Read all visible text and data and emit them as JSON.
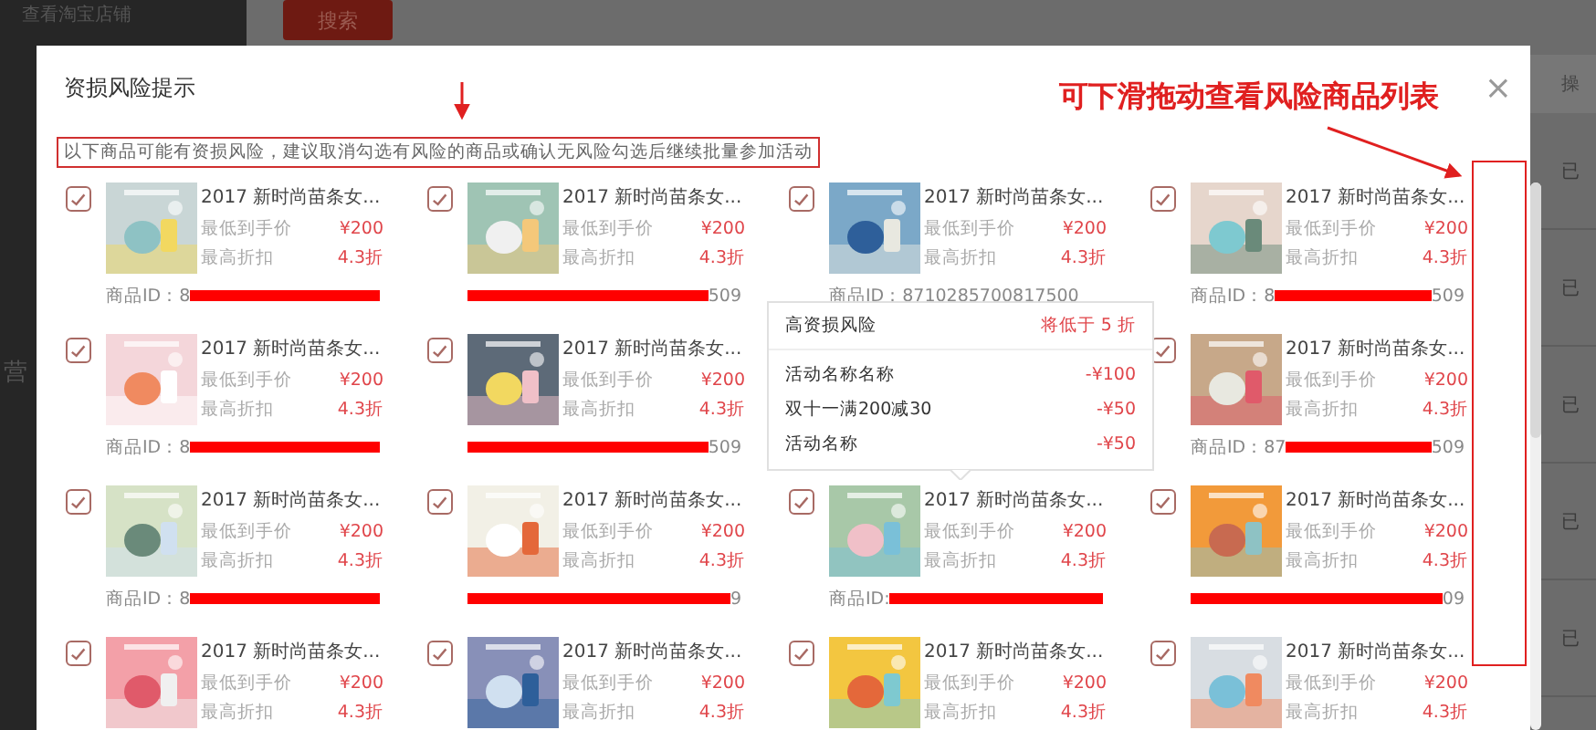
{
  "background": {
    "sidebar_items": [
      "查看淘宝店铺",
      "营"
    ],
    "search_button": "搜索",
    "table": {
      "header": "操",
      "rows": [
        "已",
        "已",
        "已",
        "已",
        "已"
      ]
    }
  },
  "dialog": {
    "title": "资损风险提示",
    "close": "×",
    "notice": "以下商品可能有资损风险，建议取消勾选有风险的商品或确认无风险勾选后继续批量参加活动",
    "rows": [
      {
        "cards": [
          {
            "kind": "product",
            "checked": true,
            "title": "2017 新时尚苗条女...",
            "price_label": "最低到手价",
            "price": "¥200",
            "discount_label": "最高折扣",
            "discount": "4.3折",
            "id_prefix": "商品ID：8",
            "redacted": true
          },
          {
            "kind": "product",
            "checked": true,
            "title": "2017 新时尚苗条女...",
            "price_label": "最低到手价",
            "price": "¥200",
            "discount_label": "最高折扣",
            "discount": "4.3折",
            "id_suffix": "509",
            "redacted": true
          },
          {
            "kind": "product",
            "checked": true,
            "title": "2017 新时尚苗条女...",
            "price_label": "最低到手价",
            "price": "¥200",
            "discount_label": "最高折扣",
            "discount": "4.3折",
            "id_prefix": "商品ID：8710285700817500",
            "redacted": false
          },
          {
            "kind": "product",
            "checked": true,
            "title": "2017 新时尚苗条女...",
            "price_label": "最低到手价",
            "price": "¥200",
            "discount_label": "最高折扣",
            "discount": "4.3折",
            "id_prefix": "商品ID：8",
            "id_suffix": "509",
            "redacted": true
          }
        ]
      },
      {
        "cards": [
          {
            "kind": "product",
            "checked": true,
            "title": "2017 新时尚苗条女...",
            "price_label": "最低到手价",
            "price": "¥200",
            "discount_label": "最高折扣",
            "discount": "4.3折",
            "id_prefix": "商品ID：8",
            "redacted": true
          },
          {
            "kind": "product",
            "checked": true,
            "title": "2017 新时尚苗条女...",
            "price_label": "最低到手价",
            "price": "¥200",
            "discount_label": "最高折扣",
            "discount": "4.3折",
            "id_suffix": "509",
            "redacted": true
          },
          {
            "kind": "popup",
            "title": "高资损风险",
            "badge": "将低于 5 折",
            "items": [
              {
                "name": "活动名称名称",
                "amount": "-¥100"
              },
              {
                "name": "双十一满200减30",
                "amount": "-¥50"
              },
              {
                "name": "活动名称",
                "amount": "-¥50"
              }
            ]
          },
          {
            "kind": "product",
            "checked": true,
            "title": "2017 新时尚苗条女...",
            "price_label": "最低到手价",
            "price": "¥200",
            "discount_label": "最高折扣",
            "discount": "4.3折",
            "id_prefix": "商品ID：87",
            "id_suffix": "509",
            "redacted": true
          }
        ]
      },
      {
        "cards": [
          {
            "kind": "product",
            "checked": true,
            "title": "2017 新时尚苗条女...",
            "price_label": "最低到手价",
            "price": "¥200",
            "discount_label": "最高折扣",
            "discount": "4.3折",
            "id_prefix": "商品ID：8",
            "redacted": true
          },
          {
            "kind": "product",
            "checked": true,
            "title": "2017 新时尚苗条女...",
            "price_label": "最低到手价",
            "price": "¥200",
            "discount_label": "最高折扣",
            "discount": "4.3折",
            "id_suffix": "9",
            "redacted": true
          },
          {
            "kind": "product",
            "checked": true,
            "title": "2017 新时尚苗条女...",
            "price_label": "最低到手价",
            "price": "¥200",
            "discount_label": "最高折扣",
            "discount": "4.3折",
            "id_prefix": "商品ID:",
            "redacted": true
          },
          {
            "kind": "product",
            "checked": true,
            "title": "2017 新时尚苗条女...",
            "price_label": "最低到手价",
            "price": "¥200",
            "discount_label": "最高折扣",
            "discount": "4.3折",
            "id_suffix": "09",
            "redacted": true
          }
        ]
      },
      {
        "cards": [
          {
            "kind": "product",
            "checked": true,
            "title": "2017 新时尚苗条女...",
            "price_label": "最低到手价",
            "price": "¥200",
            "discount_label": "最高折扣",
            "discount": "4.3折"
          },
          {
            "kind": "product",
            "checked": true,
            "title": "2017 新时尚苗条女...",
            "price_label": "最低到手价",
            "price": "¥200",
            "discount_label": "最高折扣",
            "discount": "4.3折"
          },
          {
            "kind": "product",
            "checked": true,
            "title": "2017 新时尚苗条女...",
            "price_label": "最低到手价",
            "price": "¥200",
            "discount_label": "最高折扣",
            "discount": "4.3折"
          },
          {
            "kind": "product",
            "checked": true,
            "title": "2017 新时尚苗条女...",
            "price_label": "最低到手价",
            "price": "¥200",
            "discount_label": "最高折扣",
            "discount": "4.3折"
          }
        ]
      }
    ]
  },
  "annotations": {
    "callout": "可下滑拖动查看风险商品列表"
  }
}
